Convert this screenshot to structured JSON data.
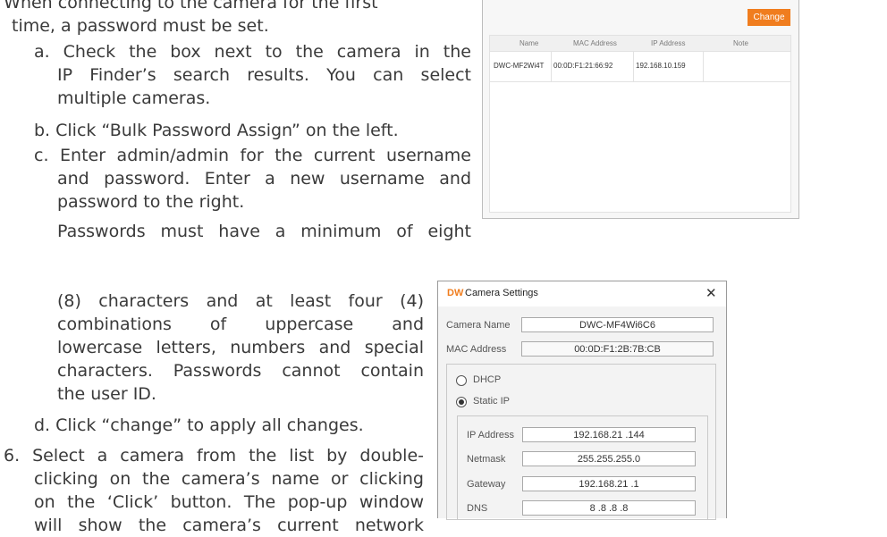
{
  "instructions": {
    "step5_line1": "5.  When connecting to the camera for the first",
    "step5_line2": "time, a password must be set.",
    "a_line1": "a. Check the box next to the camera in the",
    "a_line2": "IP Finder’s search results. You can select",
    "a_line3": "multiple cameras.",
    "b_line": "b. Click “Bulk Password Assign” on the left.",
    "c_line1": "c. Enter admin/admin for the current username",
    "c_line2": "and password. Enter a new username and",
    "c_line3": "password to the right.",
    "pw_line1": "Passwords must have a minimum of eight",
    "pw_line2": "(8) characters and at least four (4)",
    "pw_line3": "combinations of uppercase and",
    "pw_line4": "lowercase letters, numbers and special",
    "pw_line5": "characters. Passwords cannot contain",
    "pw_line6": "the user ID.",
    "d_line": "d. Click “change” to apply all changes.",
    "step6_line1": "6.  Select a camera from the list by double-",
    "step6_line2": "clicking on the camera’s name or clicking",
    "step6_line3": "on the ‘Click’ button. The pop-up window",
    "step6_line4": "will show the camera’s current network"
  },
  "camera_list": {
    "change_label": "Change",
    "columns": [
      "Name",
      "MAC Address",
      "IP Address",
      "Note"
    ],
    "rows": [
      {
        "name": "DWC-MF2Wi4T",
        "mac": "00:0D:F1:21:66:92",
        "ip": "192.168.10.159",
        "note": ""
      }
    ],
    "accent_color": "#f07d1e"
  },
  "camera_settings": {
    "logo": "DW",
    "title": "Camera Settings",
    "close": "✕",
    "camera_name_label": "Camera Name",
    "camera_name": "DWC-MF4Wi6C6",
    "mac_label": "MAC Address",
    "mac": "00:0D:F1:2B:7B:CB",
    "dhcp_label": "DHCP",
    "static_label": "Static IP",
    "selected_mode": "Static IP",
    "ip_label": "IP Address",
    "ip": "192.168.21 .144",
    "netmask_label": "Netmask",
    "netmask": "255.255.255.0",
    "gateway_label": "Gateway",
    "gateway": "192.168.21 .1",
    "dns_label": "DNS",
    "dns": "8 .8 .8 .8"
  }
}
